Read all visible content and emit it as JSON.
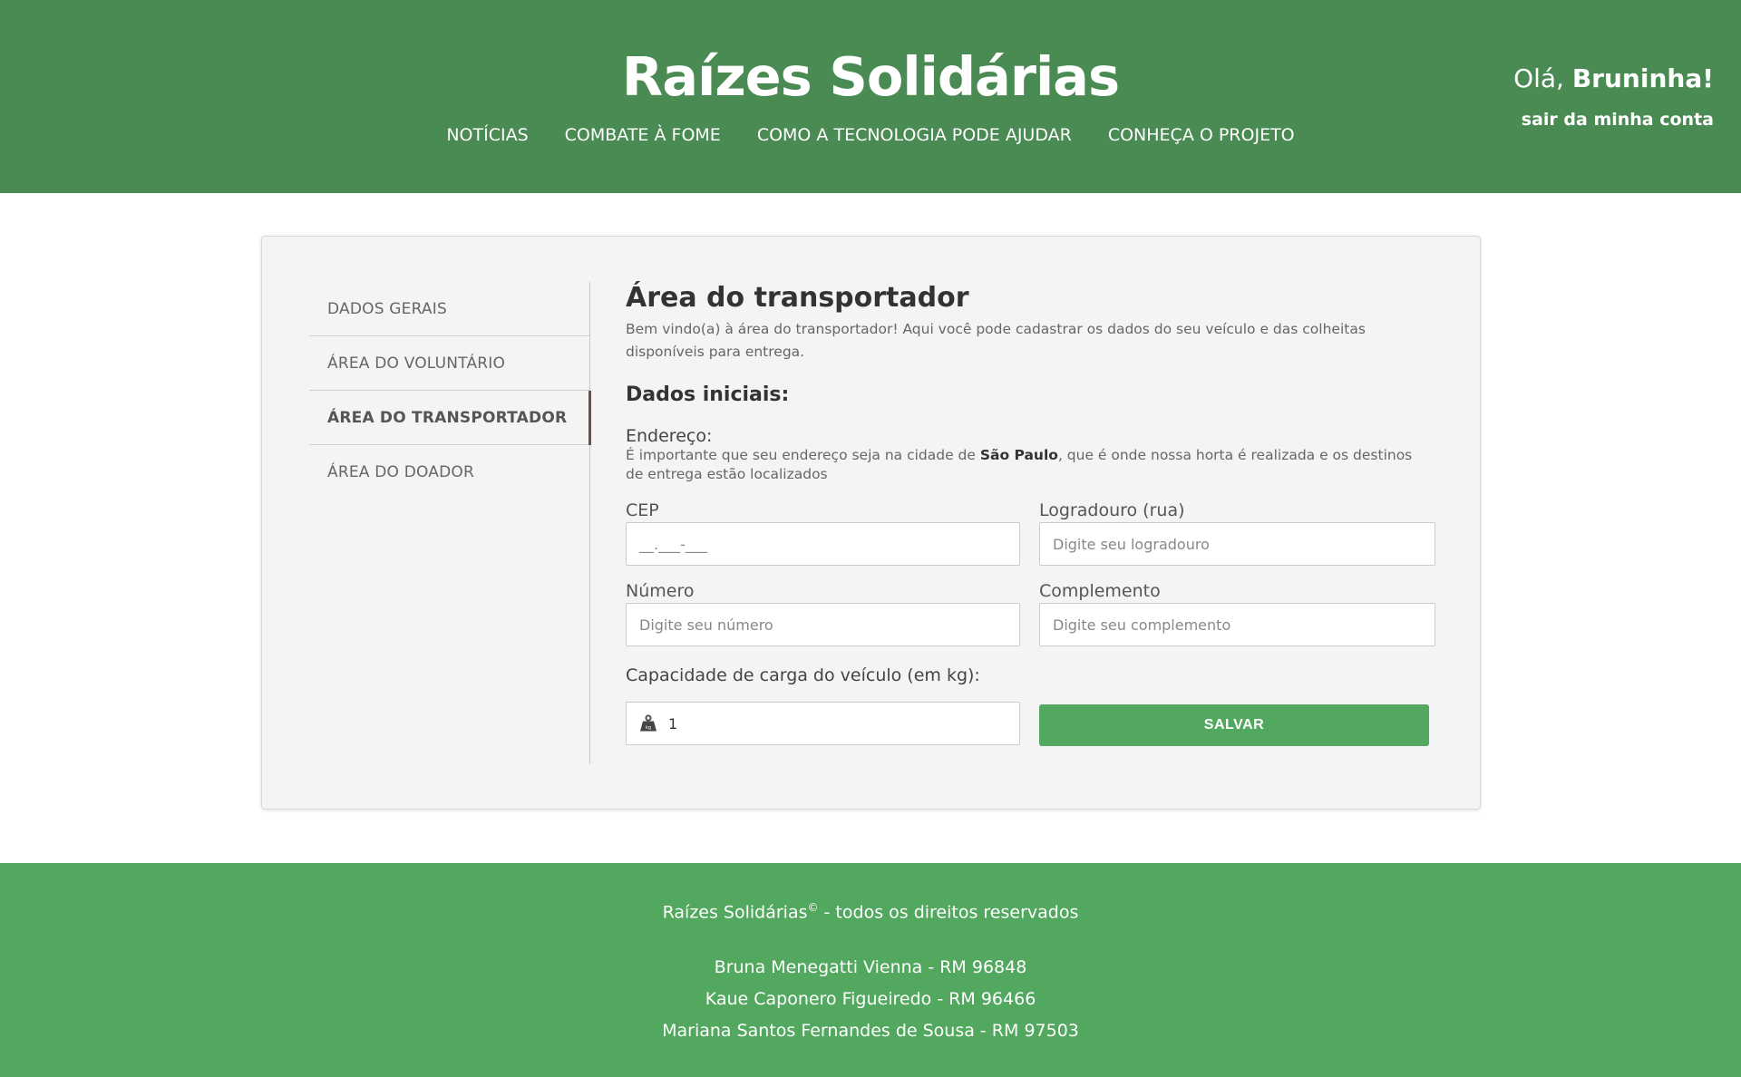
{
  "header": {
    "brand": "Raízes Solidárias",
    "nav": [
      "NOTÍCIAS",
      "COMBATE À FOME",
      "COMO A TECNOLOGIA PODE AJUDAR",
      "CONHEÇA O PROJETO"
    ],
    "greeting_prefix": "Olá, ",
    "user_name": "Bruninha!",
    "logout": "sair da minha conta"
  },
  "sidebar": {
    "items": [
      {
        "label": "DADOS GERAIS",
        "active": false
      },
      {
        "label": "ÁREA DO VOLUNTÁRIO",
        "active": false
      },
      {
        "label": "ÁREA DO TRANSPORTADOR",
        "active": true
      },
      {
        "label": "ÁREA DO DOADOR",
        "active": false
      }
    ]
  },
  "main": {
    "title": "Área do transportador",
    "intro": "Bem vindo(a) à área do transportador! Aqui você pode cadastrar os dados do seu veículo e das colheitas disponíveis para entrega.",
    "section_title": "Dados iniciais:",
    "address_label": "Endereço:",
    "address_note_before": "É importante que seu endereço seja na cidade de ",
    "address_note_city": "São Paulo",
    "address_note_after": ", que é onde nossa horta é realizada e os destinos de entrega estão localizados",
    "fields": {
      "cep": {
        "label": "CEP",
        "value": "__.___-___"
      },
      "logradouro": {
        "label": "Logradouro (rua)",
        "placeholder": "Digite seu logradouro"
      },
      "numero": {
        "label": "Número",
        "placeholder": "Digite seu número"
      },
      "complemento": {
        "label": "Complemento",
        "placeholder": "Digite seu complemento"
      }
    },
    "capacity_label": "Capacidade de carga do veículo (em kg):",
    "capacity_value": "1",
    "capacity_icon": "weight-icon",
    "save_label": "SALVAR"
  },
  "footer": {
    "brand": "Raízes Solidárias",
    "copyright_symbol": "©",
    "rights": " - todos os direitos reservados",
    "members": [
      "Bruna Menegatti Vienna - RM 96848",
      "Kaue Caponero Figueiredo - RM 96466",
      "Mariana Santos Fernandes de Sousa - RM 97503"
    ]
  },
  "colors": {
    "header_bg": "#4a8a53",
    "footer_bg": "#52a85e",
    "save_button": "#52a85e",
    "active_indicator": "#6b5045"
  }
}
